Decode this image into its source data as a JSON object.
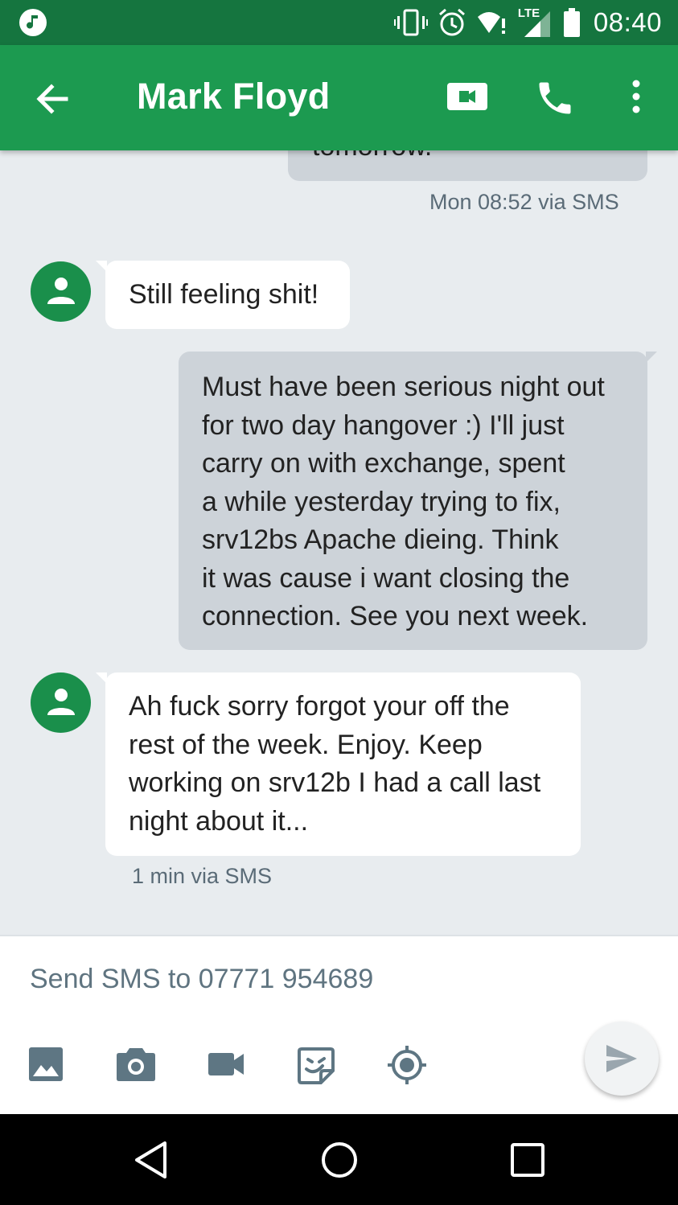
{
  "status_bar": {
    "network": "LTE",
    "time": "08:40",
    "icons": [
      "music-icon",
      "vibrate-icon",
      "alarm-icon",
      "wifi-icon",
      "signal-icon",
      "battery-icon"
    ]
  },
  "app_bar": {
    "contact_name": "Mark Floyd",
    "icons": [
      "back-arrow-icon",
      "video-call-icon",
      "phone-icon",
      "more-vert-icon"
    ]
  },
  "messages": [
    {
      "direction": "outgoing",
      "text": "tomorrow.",
      "meta": "Mon 08:52 via SMS"
    },
    {
      "direction": "incoming",
      "text": "Still feeling shit!"
    },
    {
      "direction": "outgoing",
      "lines": [
        "Must have been serious night out",
        "for two day hangover :) I'll just",
        "carry on with exchange, spent",
        "a while yesterday trying to fix,",
        "srv12bs Apache dieing. Think",
        "it was cause i want closing the",
        "connection. See you next week."
      ]
    },
    {
      "direction": "incoming",
      "lines": [
        "Ah fuck sorry forgot your off the",
        "rest of the week. Enjoy. Keep",
        "working on srv12b I had a call last",
        "night about it..."
      ],
      "meta": "1 min via SMS"
    }
  ],
  "compose": {
    "placeholder": "Send SMS to 07771 954689",
    "attachments": [
      "gallery-icon",
      "camera-icon",
      "video-icon",
      "sticker-icon",
      "location-icon"
    ],
    "send_icon": "send-icon"
  },
  "nav_bar": {
    "icons": [
      "back-triangle-icon",
      "home-circle-icon",
      "recents-square-icon"
    ]
  },
  "colors": {
    "status_bar": "#15753f",
    "app_bar": "#1c9a50",
    "avatar": "#1a8f4b",
    "outgoing_bubble": "#cdd3d9",
    "incoming_bubble": "#ffffff",
    "background": "#e8ecef"
  }
}
